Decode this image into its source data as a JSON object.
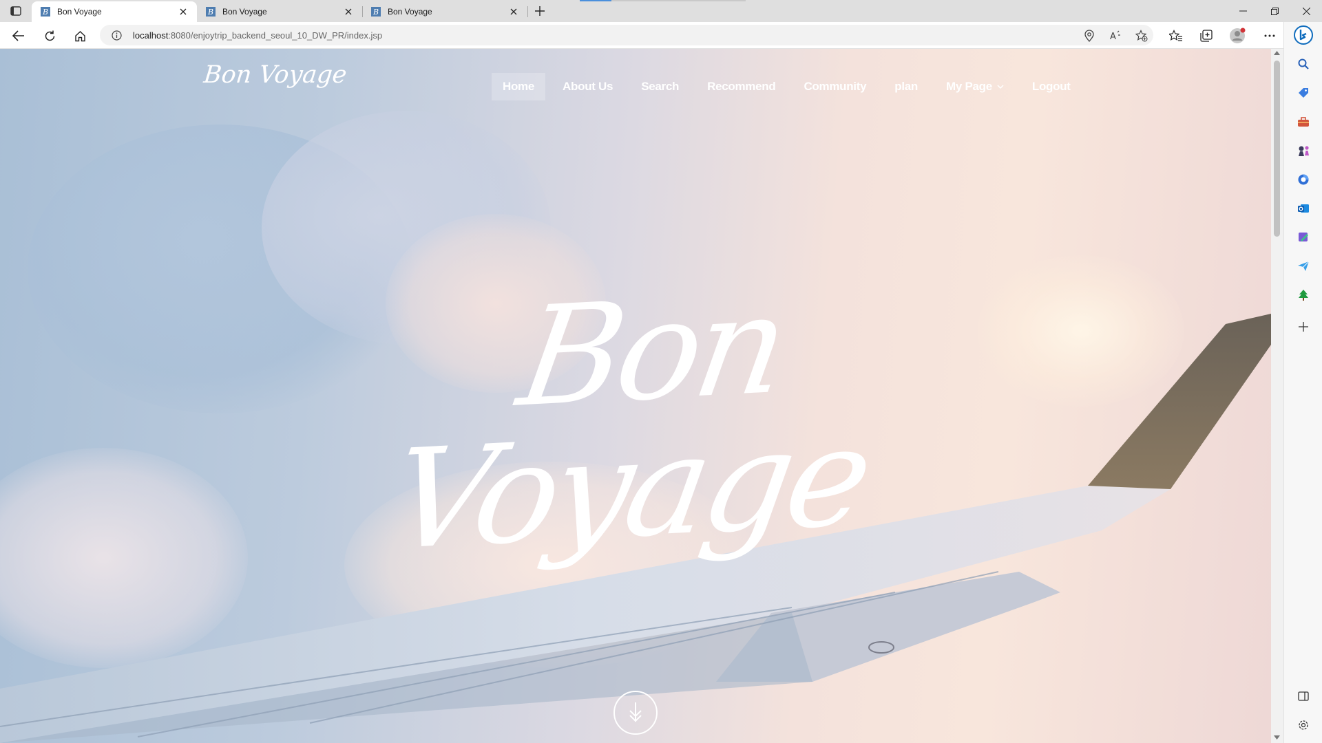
{
  "browser": {
    "tabs": [
      {
        "title": "Bon Voyage",
        "active": true
      },
      {
        "title": "Bon Voyage",
        "active": false
      },
      {
        "title": "Bon Voyage",
        "active": false
      }
    ],
    "url_host": "localhost",
    "url_rest": ":8080/enjoytrip_backend_seoul_10_DW_PR/index.jsp",
    "favicon_letter": "B"
  },
  "site": {
    "logo": "Bon Voyage",
    "nav": [
      {
        "label": "Home",
        "active": true
      },
      {
        "label": "About Us"
      },
      {
        "label": "Search"
      },
      {
        "label": "Recommend"
      },
      {
        "label": "Community"
      },
      {
        "label": "plan"
      },
      {
        "label": "My Page",
        "dropdown": true
      },
      {
        "label": "Logout"
      }
    ],
    "hero_title": "Bon Voyage"
  },
  "sidebar_icons": [
    "copilot-icon",
    "search-icon",
    "shopping-tag-icon",
    "tools-icon",
    "games-icon",
    "microsoft365-icon",
    "outlook-icon",
    "designer-icon",
    "send-icon",
    "tree-icon",
    "add-icon",
    "split-screen-icon",
    "settings-icon"
  ],
  "colors": {
    "accent": "#0f6cbd",
    "nav_text": "#ffffff"
  }
}
